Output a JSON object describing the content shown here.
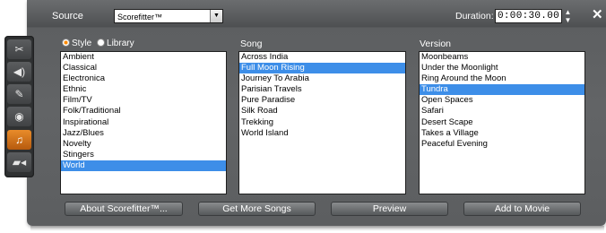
{
  "header": {
    "source_label": "Source",
    "source_value": "Scorefitter™",
    "duration_label": "Duration:",
    "duration_value": "0:00:30.00"
  },
  "toolbar": {
    "tools": [
      {
        "icon": "scissors-icon"
      },
      {
        "icon": "speaker-icon"
      },
      {
        "icon": "microphone-icon"
      },
      {
        "icon": "cd-icon"
      },
      {
        "icon": "music-note-icon",
        "active": true
      },
      {
        "icon": "camera-icon"
      }
    ]
  },
  "style_radio": {
    "style_label": "Style",
    "library_label": "Library",
    "selected": "Style"
  },
  "columns": {
    "song_label": "Song",
    "version_label": "Version"
  },
  "styles": {
    "items": [
      "Ambient",
      "Classical",
      "Electronica",
      "Ethnic",
      "Film/TV",
      "Folk/Traditional",
      "Inspirational",
      "Jazz/Blues",
      "Novelty",
      "Stingers",
      "World"
    ],
    "selected": "World"
  },
  "songs": {
    "items": [
      "Across India",
      "Full Moon Rising",
      "Journey To Arabia",
      "Parisian Travels",
      "Pure Paradise",
      "Silk Road",
      "Trekking",
      "World Island"
    ],
    "selected": "Full Moon Rising"
  },
  "versions": {
    "items": [
      "Moonbeams",
      "Under the Moonlight",
      "Ring Around the Moon",
      "Tundra",
      "Open Spaces",
      "Safari",
      "Desert Scape",
      "Takes a Village",
      "Peaceful Evening"
    ],
    "selected": "Tundra"
  },
  "buttons": {
    "about": "About Scorefitter™...",
    "more_songs": "Get More Songs",
    "preview": "Preview",
    "add": "Add to Movie"
  },
  "colors": {
    "selection": "#3d8ee8",
    "accent": "#e98c2a",
    "panel": "#5c5e60"
  }
}
